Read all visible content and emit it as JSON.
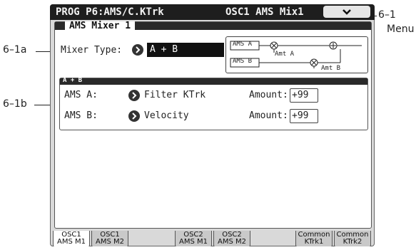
{
  "callouts": {
    "menu_num": "6–1",
    "menu_word": "Menu",
    "mixer_type": "6–1a",
    "sub_section": "6–1b"
  },
  "header": {
    "left": "PROG P6:AMS/C.KTrk",
    "right": "OSC1 AMS Mix1",
    "menu_icon": "chevron-down-icon"
  },
  "section": {
    "title": "AMS Mixer 1",
    "mixer_type_label": "Mixer Type:",
    "mixer_type_value": "A + B"
  },
  "diagram": {
    "in_a": "AMS A",
    "in_b": "AMS B",
    "amt_a": "Amt A",
    "amt_b": "Amt B"
  },
  "sub_section": {
    "title": "A + B",
    "rows": [
      {
        "label": "AMS A:",
        "source": "Filter KTrk",
        "amount_label": "Amount:",
        "amount": "+99"
      },
      {
        "label": "AMS B:",
        "source": "Velocity",
        "amount_label": "Amount:",
        "amount": "+99"
      }
    ]
  },
  "tabs": [
    {
      "line1": "OSC1",
      "line2": "AMS M1",
      "active": true
    },
    {
      "line1": "OSC1",
      "line2": "AMS M2",
      "active": false
    },
    {
      "line1": "OSC2",
      "line2": "AMS M1",
      "active": false
    },
    {
      "line1": "OSC2",
      "line2": "AMS M2",
      "active": false
    },
    {
      "line1": "Common",
      "line2": "KTrk1",
      "active": false
    },
    {
      "line1": "Common",
      "line2": "KTrk2",
      "active": false
    }
  ]
}
